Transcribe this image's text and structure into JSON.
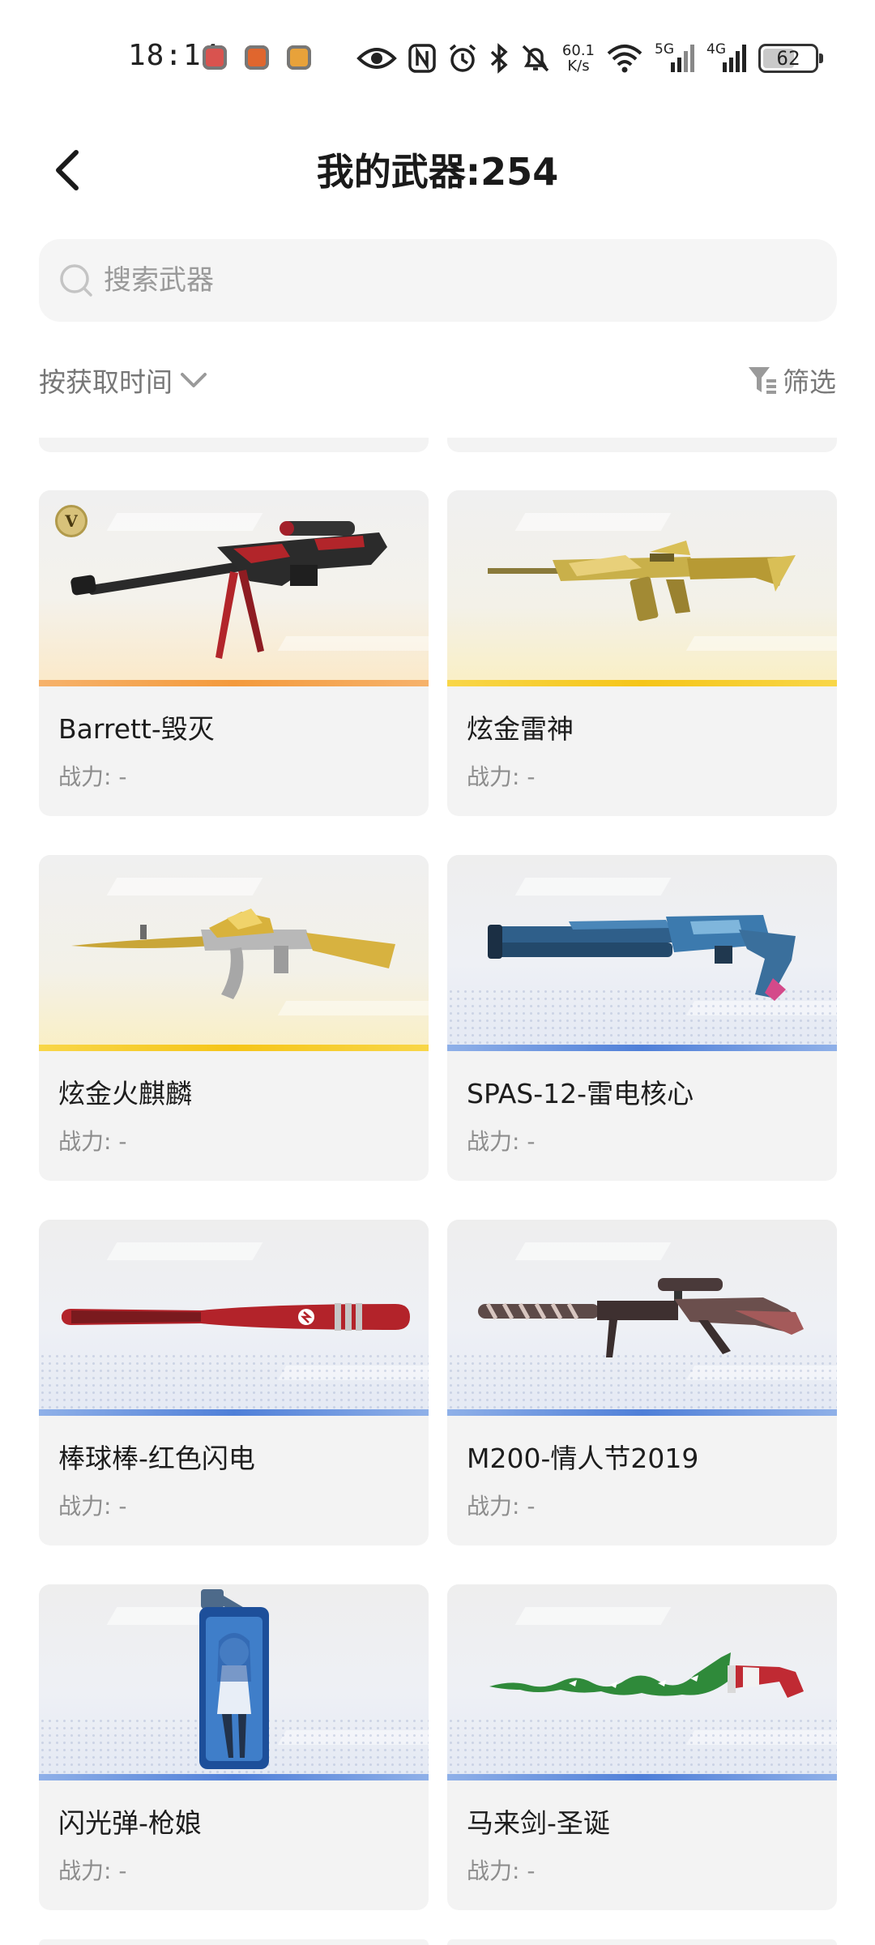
{
  "status_bar": {
    "time": "18:14",
    "network_speed_value": "60.1",
    "network_speed_unit": "K/s",
    "signal_1": "5G",
    "signal_2": "4G",
    "battery": "62",
    "battery_level": 0.62
  },
  "header": {
    "title": "我的武器:254"
  },
  "search": {
    "placeholder": "搜索武器",
    "value": ""
  },
  "sort": {
    "label": "按获取时间"
  },
  "filter": {
    "label": "筛选"
  },
  "power_label": "战力: -",
  "weapons": [
    {
      "name": "Barrett-毁灭",
      "power": "战力: -",
      "rarity": "gold",
      "badge": "V",
      "icon": "sniper-rifle-icon"
    },
    {
      "name": "炫金雷神",
      "power": "战力: -",
      "rarity": "yellow",
      "icon": "assault-rifle-icon"
    },
    {
      "name": "炫金火麒麟",
      "power": "战力: -",
      "rarity": "yellow",
      "icon": "ak-rifle-icon"
    },
    {
      "name": "SPAS-12-雷电核心",
      "power": "战力: -",
      "rarity": "blue",
      "icon": "shotgun-icon"
    },
    {
      "name": "棒球棒-红色闪电",
      "power": "战力: -",
      "rarity": "blue",
      "icon": "baseball-bat-icon"
    },
    {
      "name": "M200-情人节2019",
      "power": "战力: -",
      "rarity": "blue",
      "icon": "sniper-rifle-icon"
    },
    {
      "name": "闪光弹-枪娘",
      "power": "战力: -",
      "rarity": "blue",
      "icon": "flash-grenade-icon"
    },
    {
      "name": "马来剑-圣诞",
      "power": "战力: -",
      "rarity": "blue",
      "icon": "kris-sword-icon"
    }
  ],
  "colors": {
    "rarity_gold": "#f39a3c",
    "rarity_yellow": "#f5c518",
    "rarity_blue": "#4f7fd8",
    "card_bg": "#f3f3f3",
    "search_bg": "#f5f5f5"
  }
}
